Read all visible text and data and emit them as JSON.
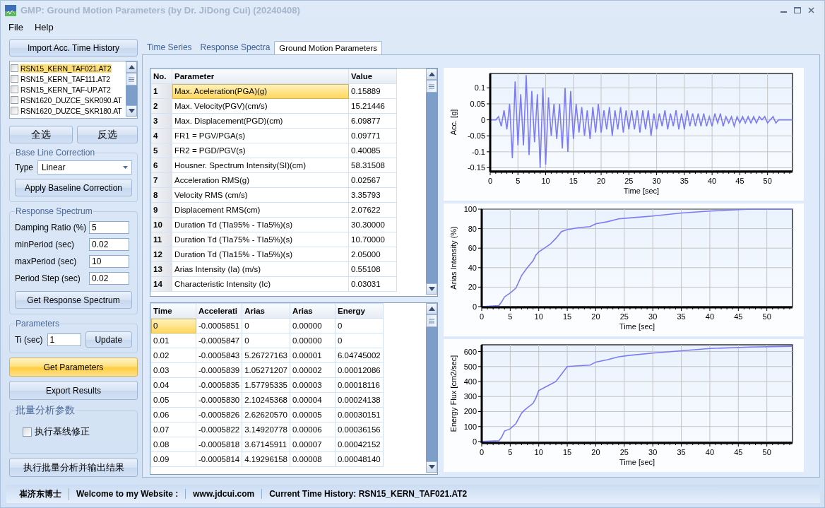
{
  "window": {
    "title": "GMP: Ground Motion Parameters (by Dr. JiDong Cui) (20240408)"
  },
  "menu": [
    "File",
    "Help"
  ],
  "sidebar": {
    "import_button": "Import Acc. Time History",
    "files": [
      {
        "name": "RSN15_KERN_TAF021.AT2",
        "checked": false,
        "selected": true
      },
      {
        "name": "RSN15_KERN_TAF111.AT2",
        "checked": false,
        "selected": false
      },
      {
        "name": "RSN15_KERN_TAF-UP.AT2",
        "checked": false,
        "selected": false
      },
      {
        "name": "RSN1620_DUZCE_SKR090.AT",
        "checked": false,
        "selected": false
      },
      {
        "name": "RSN1620_DUZCE_SKR180.AT",
        "checked": false,
        "selected": false
      }
    ],
    "select_buttons": [
      "全选",
      "反选"
    ],
    "baseline": {
      "title": "Base Line Correction",
      "type_label": "Type",
      "type_value": "Linear",
      "button": "Apply Baseline Correction"
    },
    "response_spectrum": {
      "title": "Response Spectrum",
      "fields": [
        {
          "label": "Damping Ratio (%)",
          "value": "5"
        },
        {
          "label": "minPeriod (sec)",
          "value": "0.02"
        },
        {
          "label": "maxPeriod (sec)",
          "value": "10"
        },
        {
          "label": "Period Step (sec)",
          "value": "0.02"
        }
      ],
      "button": "Get Response Spectrum"
    },
    "parameters": {
      "title": "Parameters",
      "label": "Ti (sec)",
      "value": "1",
      "button": "Update"
    },
    "actions": [
      {
        "label": "Get Parameters",
        "selected": true
      },
      {
        "label": "Export Results",
        "selected": false
      }
    ],
    "batch": {
      "title": "批量分析参数",
      "checkbox": {
        "label": "执行基线修正",
        "checked": false
      },
      "button": "执行批量分析并输出结果"
    }
  },
  "tabs": [
    {
      "label": "Time Series",
      "selected": false
    },
    {
      "label": "Response Spectra",
      "selected": false
    },
    {
      "label": "Ground Motion Parameters",
      "selected": true
    }
  ],
  "parameter_table": {
    "columns": [
      "No.",
      "Parameter",
      "Value"
    ],
    "rows": [
      {
        "no": "1",
        "parameter": "Max. Aceleration(PGA)(g)",
        "value": "0.15889",
        "selected": true
      },
      {
        "no": "2",
        "parameter": "Max. Velocity(PGV)(cm/s)",
        "value": "15.21446",
        "selected": false
      },
      {
        "no": "3",
        "parameter": "Max. Displacement(PGD)(cm)",
        "value": "6.09877",
        "selected": false
      },
      {
        "no": "4",
        "parameter": "FR1 = PGV/PGA(s)",
        "value": "0.09771",
        "selected": false
      },
      {
        "no": "5",
        "parameter": "FR2 = PGD/PGV(s)",
        "value": "0.40085",
        "selected": false
      },
      {
        "no": "6",
        "parameter": "Housner. Spectrum Intensity(SI)(cm)",
        "value": "58.31508",
        "selected": false
      },
      {
        "no": "7",
        "parameter": "Acceleration RMS(g)",
        "value": "0.02567",
        "selected": false
      },
      {
        "no": "8",
        "parameter": "Velocity RMS (cm/s)",
        "value": "3.35793",
        "selected": false
      },
      {
        "no": "9",
        "parameter": "Displacement RMS(cm)",
        "value": "2.07622",
        "selected": false
      },
      {
        "no": "10",
        "parameter": "Duration Td (TIa95% - TIa5%)(s)",
        "value": "30.30000",
        "selected": false
      },
      {
        "no": "11",
        "parameter": "Duration Td (TIa75% - TIa5%)(s)",
        "value": "10.70000",
        "selected": false
      },
      {
        "no": "12",
        "parameter": "Duration Td (TIa15% - TIa5%)(s)",
        "value": "2.05000",
        "selected": false
      },
      {
        "no": "13",
        "parameter": "Arias Intensity (Ia) (m/s)",
        "value": "0.55108",
        "selected": false
      },
      {
        "no": "14",
        "parameter": "Characteristic Intensity (Ic)",
        "value": "0.03031",
        "selected": false
      }
    ]
  },
  "history_table": {
    "columns": [
      "Time",
      "Accelerati",
      "Arias",
      "Arias",
      "Energy"
    ],
    "rows": [
      {
        "cells": [
          "0",
          "-0.0005851",
          "0",
          "0.00000",
          "0"
        ],
        "selected": true
      },
      {
        "cells": [
          "0.01",
          "-0.0005847",
          "0",
          "0.00000",
          "0"
        ],
        "selected": false
      },
      {
        "cells": [
          "0.02",
          "-0.0005843",
          "5.26727163",
          "0.00001",
          "6.04745002"
        ],
        "selected": false
      },
      {
        "cells": [
          "0.03",
          "-0.0005839",
          "1.05271207",
          "0.00002",
          "0.00012086"
        ],
        "selected": false
      },
      {
        "cells": [
          "0.04",
          "-0.0005835",
          "1.57795335",
          "0.00003",
          "0.00018116"
        ],
        "selected": false
      },
      {
        "cells": [
          "0.05",
          "-0.0005830",
          "2.10245368",
          "0.00004",
          "0.00024138"
        ],
        "selected": false
      },
      {
        "cells": [
          "0.06",
          "-0.0005826",
          "2.62620570",
          "0.00005",
          "0.00030151"
        ],
        "selected": false
      },
      {
        "cells": [
          "0.07",
          "-0.0005822",
          "3.14920778",
          "0.00006",
          "0.00036156"
        ],
        "selected": false
      },
      {
        "cells": [
          "0.08",
          "-0.0005818",
          "3.67145911",
          "0.00007",
          "0.00042152"
        ],
        "selected": false
      },
      {
        "cells": [
          "0.09",
          "-0.0005814",
          "4.19296158",
          "0.00008",
          "0.00048140"
        ],
        "selected": false
      }
    ]
  },
  "charts": [
    {
      "chart_data": {
        "type": "line",
        "xlabel": "Time [sec]",
        "ylabel": "Acc. [g]",
        "xlim": [
          0,
          54.5
        ],
        "ylim": [
          -0.16,
          0.145
        ],
        "xticks": [
          0,
          5,
          10,
          15,
          20,
          25,
          30,
          35,
          40,
          45,
          50
        ],
        "yticks": [
          {
            "value": -0.15,
            "label": "-0.15"
          },
          {
            "value": -0.1,
            "label": "-0.1"
          },
          {
            "value": -0.05,
            "label": "-0.05"
          },
          {
            "value": 0,
            "label": "0"
          },
          {
            "value": 0.05,
            "label": "0.05"
          },
          {
            "value": 0.1,
            "label": "0.1"
          }
        ],
        "x": [
          0,
          0.5,
          1,
          1.5,
          2,
          2.5,
          3,
          3.5,
          4,
          4.5,
          5,
          5.5,
          6,
          6.5,
          7,
          7.5,
          8,
          8.5,
          9,
          9.5,
          10,
          10.5,
          11,
          11.5,
          12,
          12.5,
          13,
          13.5,
          14,
          14.5,
          15,
          15.5,
          16,
          16.5,
          17,
          17.5,
          18,
          18.5,
          19,
          19.5,
          20,
          20.5,
          21,
          21.5,
          22,
          22.5,
          23,
          23.5,
          24,
          24.5,
          25,
          25.5,
          26,
          26.5,
          27,
          27.5,
          28,
          28.5,
          29,
          29.5,
          30,
          30.5,
          31,
          31.5,
          32,
          32.5,
          33,
          33.5,
          34,
          34.5,
          35,
          35.5,
          36,
          36.5,
          37,
          37.5,
          38,
          38.5,
          39,
          39.5,
          40,
          40.5,
          41,
          41.5,
          42,
          42.5,
          43,
          43.5,
          44,
          44.5,
          45,
          45.5,
          46,
          46.5,
          47,
          47.5,
          48,
          48.5,
          49,
          49.5,
          50,
          50.5,
          51,
          51.5,
          52,
          52.5,
          53,
          53.5,
          54,
          54.5
        ],
        "grid": true,
        "series": [
          {
            "color": "#7b7bf5",
            "values": [
              0,
              0,
              0,
              0.01,
              -0.02,
              0.03,
              -0.03,
              0.05,
              -0.12,
              0.12,
              -0.08,
              0.08,
              -0.08,
              0.14,
              -0.11,
              0.09,
              -0.07,
              0.08,
              -0.15,
              0.1,
              -0.14,
              0.07,
              -0.05,
              0.05,
              -0.06,
              0.05,
              -0.09,
              0.1,
              -0.1,
              0.09,
              -0.06,
              0.05,
              -0.04,
              0.04,
              -0.05,
              0.03,
              -0.06,
              0.04,
              -0.04,
              0.05,
              -0.04,
              0.03,
              -0.03,
              0.04,
              -0.05,
              0.03,
              -0.03,
              0.04,
              -0.04,
              0.03,
              -0.03,
              0.03,
              -0.03,
              0.03,
              -0.04,
              0.03,
              -0.03,
              0.03,
              -0.05,
              0.02,
              -0.03,
              0.02,
              -0.02,
              0.03,
              -0.03,
              0.02,
              -0.02,
              0.03,
              -0.03,
              0.02,
              -0.03,
              0.03,
              -0.02,
              0.02,
              -0.02,
              0.02,
              -0.02,
              0.02,
              -0.02,
              0.01,
              -0.02,
              0.02,
              -0.01,
              0.02,
              -0.02,
              0.01,
              -0.01,
              0.01,
              -0.02,
              0.01,
              -0.01,
              0.01,
              -0.01,
              0.01,
              -0.01,
              0.01,
              -0.01,
              0.01,
              0,
              0.01,
              -0.01,
              0,
              0.01,
              -0.01,
              0,
              0,
              0,
              0,
              0,
              0
            ]
          }
        ]
      }
    },
    {
      "chart_data": {
        "type": "line",
        "xlabel": "Time [sec]",
        "ylabel": "Arias Intensity (%)",
        "xlim": [
          0,
          54.5
        ],
        "ylim": [
          0,
          100
        ],
        "xticks": [
          0,
          5,
          10,
          15,
          20,
          25,
          30,
          35,
          40,
          45,
          50
        ],
        "yticks": [
          0,
          20,
          40,
          60,
          80,
          100
        ],
        "x": [
          0,
          3,
          3.5,
          4,
          5,
          6,
          7,
          7.5,
          8,
          9,
          9.5,
          10,
          11,
          12,
          13,
          14,
          15,
          17,
          19,
          20,
          22,
          24,
          26,
          30,
          35,
          40,
          47,
          54.5
        ],
        "grid": true,
        "series": [
          {
            "color": "#7b7bf5",
            "values": [
              0,
              1,
              5,
              10,
              14,
              19,
              32,
              36,
              40,
              47,
              53,
              56,
              60,
              64,
              70,
              77,
              79,
              81,
              82,
              85,
              87,
              90,
              91,
              93,
              96,
              98,
              100,
              100
            ]
          }
        ]
      }
    },
    {
      "chart_data": {
        "type": "line",
        "xlabel": "Time [sec]",
        "ylabel": "Energy Flux [cm2/sec]",
        "xlim": [
          0,
          54.5
        ],
        "ylim": [
          -5,
          645
        ],
        "xticks": [
          0,
          5,
          10,
          15,
          20,
          25,
          30,
          35,
          40,
          45,
          50
        ],
        "yticks": [
          0,
          100,
          200,
          300,
          400,
          500,
          600
        ],
        "x": [
          0,
          3,
          3.5,
          4,
          5,
          6,
          7,
          7.5,
          8,
          9,
          9.5,
          10,
          11,
          12,
          13,
          14,
          15,
          17,
          19,
          20,
          22,
          24,
          26,
          30,
          35,
          40,
          47,
          54.5
        ],
        "grid": true,
        "series": [
          {
            "color": "#7b7bf5",
            "values": [
              0,
              5,
              30,
              70,
              85,
              120,
              190,
              210,
              225,
              255,
              290,
              340,
              360,
              380,
              400,
              450,
              500,
              505,
              510,
              530,
              545,
              565,
              575,
              590,
              605,
              620,
              630,
              635
            ]
          }
        ]
      }
    }
  ],
  "status_bar": [
    "崔济东博士",
    "Welcome to my Website :",
    "www.jdcui.com",
    "Current Time History: RSN15_KERN_TAF021.AT2"
  ]
}
